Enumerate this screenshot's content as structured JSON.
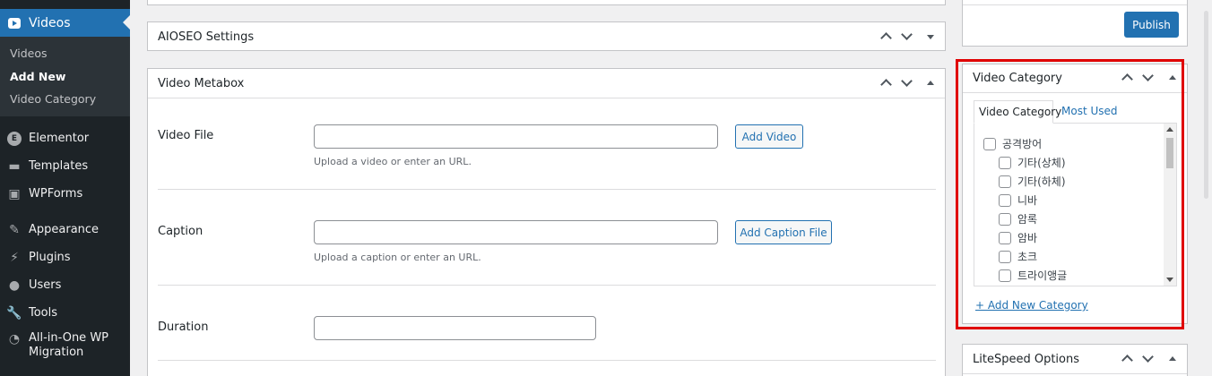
{
  "sidebar": {
    "active": "Videos",
    "submenu": [
      "Videos",
      "Add New",
      "Video Category"
    ],
    "items": [
      "Elementor",
      "Templates",
      "WPForms",
      "Appearance",
      "Plugins",
      "Users",
      "Tools",
      "All-in-One WP",
      "Migration"
    ]
  },
  "aioseo": {
    "title": "AIOSEO Settings"
  },
  "video_metabox": {
    "title": "Video Metabox",
    "video_file": {
      "label": "Video File",
      "value": "",
      "button": "Add Video",
      "hint": "Upload a video or enter an URL."
    },
    "caption": {
      "label": "Caption",
      "value": "",
      "button": "Add Caption File",
      "hint": "Upload a caption or enter an URL."
    },
    "duration": {
      "label": "Duration",
      "value": ""
    }
  },
  "publish": {
    "button": "Publish"
  },
  "video_category": {
    "title": "Video Category",
    "tabs": [
      "Video Category",
      "Most Used"
    ],
    "categories": [
      "공격방어",
      "기타(상체)",
      "기타(하체)",
      "니바",
      "암록",
      "암바",
      "초크",
      "트라이앵글"
    ],
    "add_new": "+ Add New Category"
  },
  "litespeed": {
    "title": "LiteSpeed Options"
  },
  "colors": {
    "accent": "#2271b1",
    "sidebar": "#1d2327",
    "highlight": "#e00000"
  }
}
